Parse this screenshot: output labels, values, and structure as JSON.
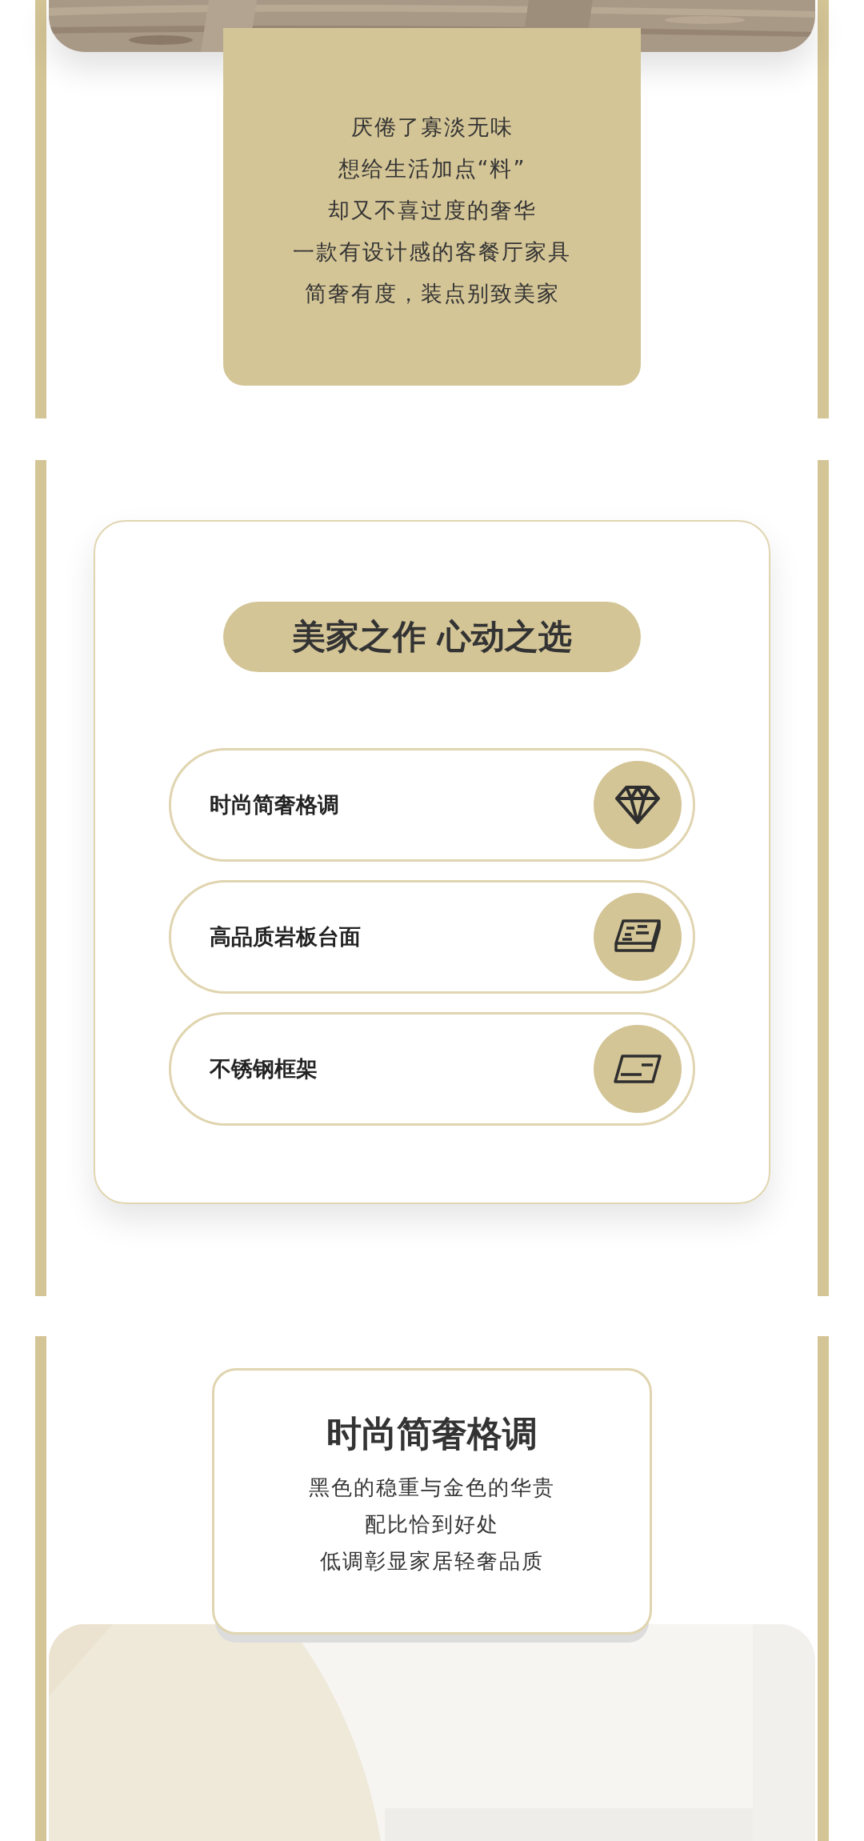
{
  "intro": {
    "lines": [
      "厌倦了寡淡无味",
      "想给生活加点“料”",
      "却又不喜过度的奢华",
      "一款有设计感的客餐厅家具",
      "简奢有度，装点别致美家"
    ]
  },
  "highlights": {
    "title": "美家之作 心动之选",
    "items": [
      {
        "label": "时尚简奢格调",
        "kind": "diamond"
      },
      {
        "label": "高品质岩板台面",
        "kind": "slab"
      },
      {
        "label": "不锈钢框架",
        "kind": "frame"
      }
    ]
  },
  "feature": {
    "title": "时尚简奢格调",
    "lines": [
      "黑色的稳重与金色的华贵",
      "配比恰到好处",
      "低调彰显家居轻奢品质"
    ]
  }
}
